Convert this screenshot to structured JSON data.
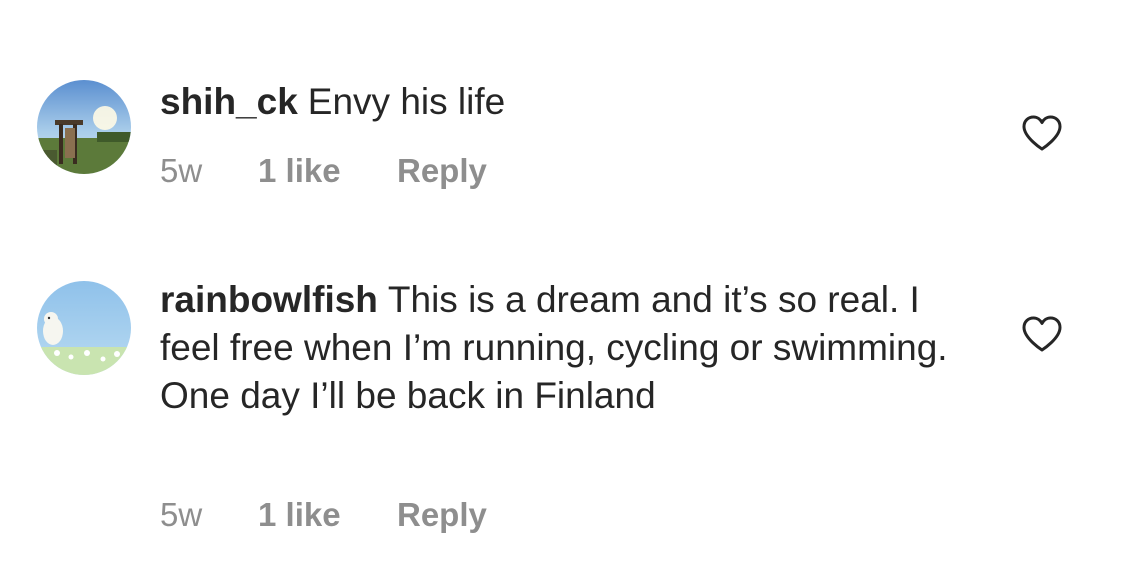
{
  "comments": [
    {
      "username": "shih_ck",
      "text": "Envy his life",
      "time": "5w",
      "likes": "1 like",
      "reply": "Reply",
      "avatar_icon": "landscape-photo-avatar",
      "like_icon": "heart-outline-icon"
    },
    {
      "username": "rainbowlfish",
      "text": "This is a dream and it’s so real. I feel free when I’m running, cycling or swimming. One day I’ll be back in Finland",
      "time": "5w",
      "likes": "1 like",
      "reply": "Reply",
      "avatar_icon": "cartoon-sky-avatar",
      "like_icon": "heart-outline-icon"
    }
  ],
  "colors": {
    "text": "#262626",
    "secondary": "#8e8e8e",
    "background": "#ffffff"
  }
}
